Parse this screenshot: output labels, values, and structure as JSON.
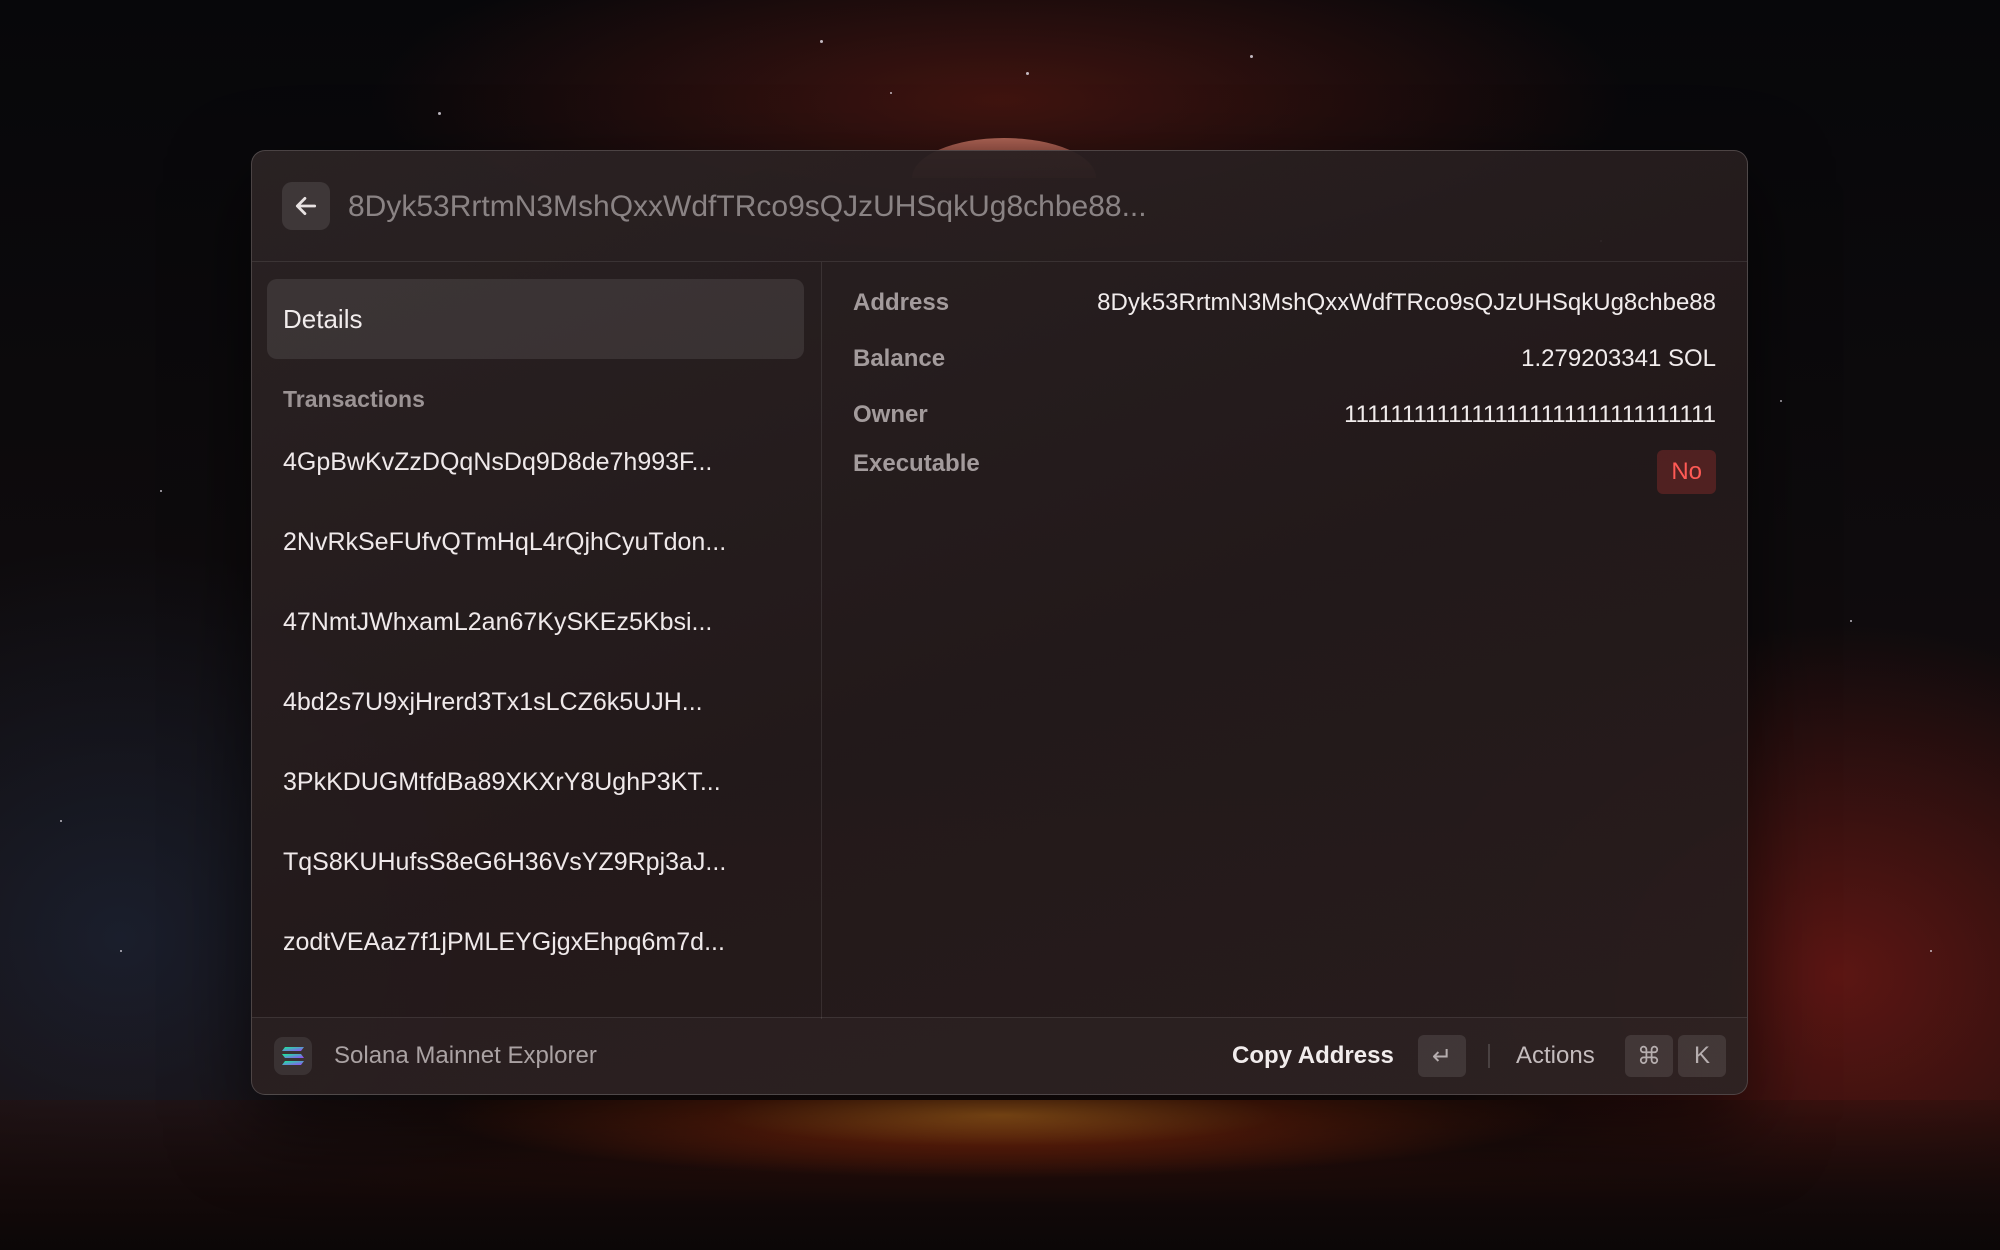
{
  "search": {
    "value": "",
    "placeholder": "8Dyk53RrtmN3MshQxxWdfTRco9sQJzUHSqkUg8chbe88..."
  },
  "sidebar": {
    "selected_item": "Details",
    "section_label": "Transactions",
    "transactions": [
      "4GpBwKvZzDQqNsDq9D8de7h993F...",
      "2NvRkSeFUfvQTmHqL4rQjhCyuTdon...",
      "47NmtJWhxamL2an67KySKEz5Kbsi...",
      "4bd2s7U9xjHrerd3Tx1sLCZ6k5UJH...",
      "3PkKDUGMtfdBa89XKXrY8UghP3KT...",
      "TqS8KUHufsS8eG6H36VsYZ9Rpj3aJ...",
      "zodtVEAaz7f1jPMLEYGjgxEhpq6m7d..."
    ]
  },
  "details": {
    "address_label": "Address",
    "address_value": "8Dyk53RrtmN3MshQxxWdfTRco9sQJzUHSqkUg8chbe88",
    "balance_label": "Balance",
    "balance_value": "1.279203341 SOL",
    "owner_label": "Owner",
    "owner_value": "11111111111111111111111111111111",
    "executable_label": "Executable",
    "executable_value": "No"
  },
  "footer": {
    "app_name": "Solana Mainnet Explorer",
    "primary_action": "Copy Address",
    "primary_key": "↵",
    "actions_label": "Actions",
    "actions_keys": [
      "⌘",
      "K"
    ]
  },
  "colors": {
    "accent_negative": "#ff5a55",
    "logo_gradient": [
      "#9945FF",
      "#14F195"
    ]
  }
}
